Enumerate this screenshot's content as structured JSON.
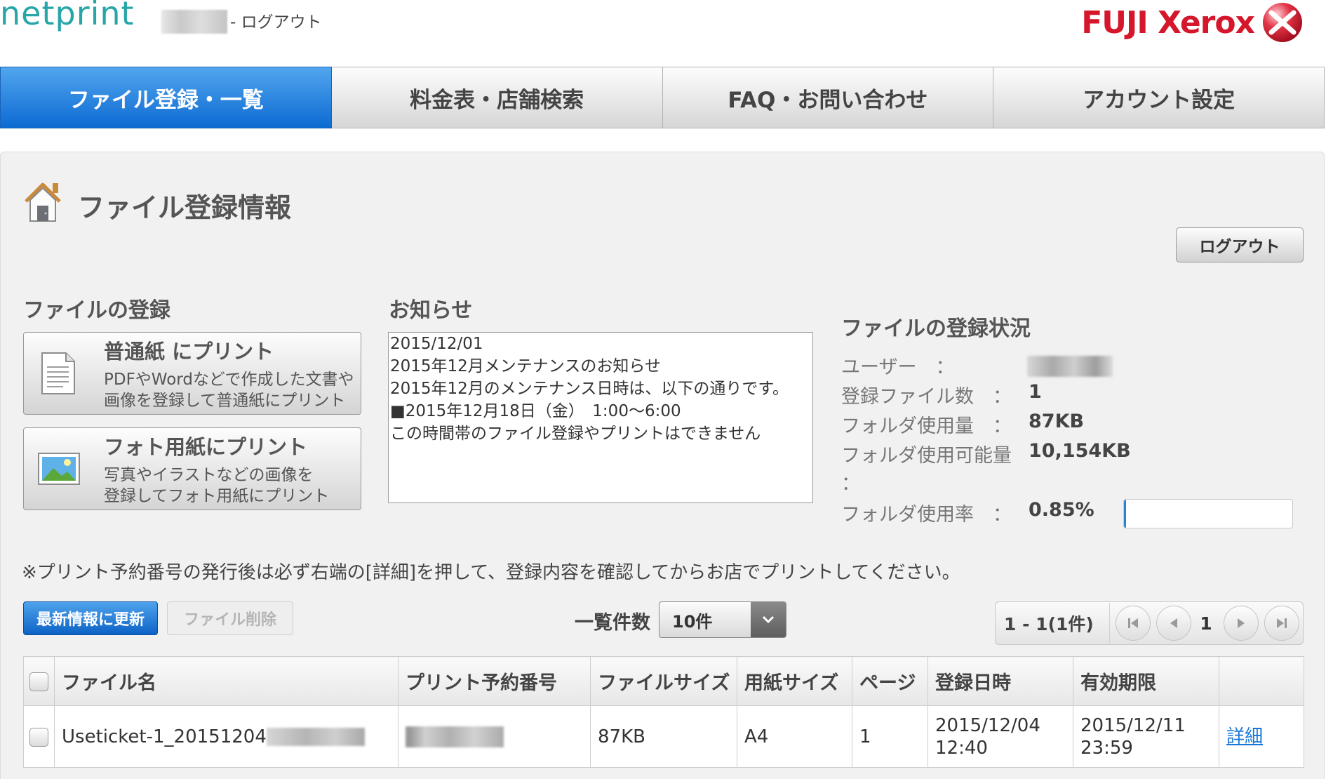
{
  "header": {
    "logo": "netprint",
    "logout_link": "- ログアウト",
    "brand": "FUJI Xerox"
  },
  "nav": {
    "tabs": [
      {
        "label": "ファイル登録・一覧",
        "active": true
      },
      {
        "label": "料金表・店舗検索",
        "active": false
      },
      {
        "label": "FAQ・お問い合わせ",
        "active": false
      },
      {
        "label": "アカウント設定",
        "active": false
      }
    ]
  },
  "page": {
    "title": "ファイル登録情報",
    "logout_button": "ログアウト"
  },
  "registration": {
    "heading": "ファイルの登録",
    "plain": {
      "title": "普通紙 にプリント",
      "desc1": "PDFやWordなどで作成した文書や",
      "desc2": "画像を登録して普通紙にプリント"
    },
    "photo": {
      "title": "フォト用紙にプリント",
      "desc1": "写真やイラストなどの画像を",
      "desc2": "登録してフォト用紙にプリント"
    }
  },
  "news": {
    "heading": "お知らせ",
    "lines": [
      "2015/12/01",
      "2015年12月メンテナンスのお知らせ",
      "",
      "2015年12月のメンテナンス日時は、以下の通りです。",
      "",
      "■2015年12月18日（金）　1:00〜6:00",
      "",
      "この時間帯のファイル登録やプリントはできません"
    ]
  },
  "status": {
    "heading": "ファイルの登録状況",
    "user_label": "ユーザー　：",
    "files_label": "登録ファイル数　：",
    "files_value": "1",
    "used_label": "フォルダ使用量　：",
    "used_value": "87KB",
    "avail_label": "フォルダ使用可能量",
    "avail_colon": "：",
    "avail_value": "10,154KB",
    "rate_label": "フォルダ使用率　：",
    "rate_value": "0.85%",
    "rate_fraction": 0.0085
  },
  "notice": "※プリント予約番号の発行後は必ず右端の[詳細]を押して、登録内容を確認してからお店でプリントしてください。",
  "toolbar": {
    "refresh": "最新情報に更新",
    "delete": "ファイル削除",
    "perpage_label": "一覧件数",
    "perpage_value": "10件"
  },
  "pager": {
    "range": "1 - 1(1件)",
    "current": "1"
  },
  "table": {
    "headers": [
      "ファイル名",
      "プリント予約番号",
      "ファイルサイズ",
      "用紙サイズ",
      "ページ",
      "登録日時",
      "有効期限"
    ],
    "rows": [
      {
        "filename": "Useticket-1_20151204",
        "size": "87KB",
        "paper": "A4",
        "pages": "1",
        "reg_date": "2015/12/04",
        "reg_time": "12:40",
        "exp_date": "2015/12/11",
        "exp_time": "23:59",
        "detail": "詳細"
      }
    ]
  },
  "colors": {
    "brand_teal": "#27a6a8",
    "xerox_red": "#d5172b",
    "active_tab": "#0c6ad2",
    "link_blue": "#1877d4"
  }
}
